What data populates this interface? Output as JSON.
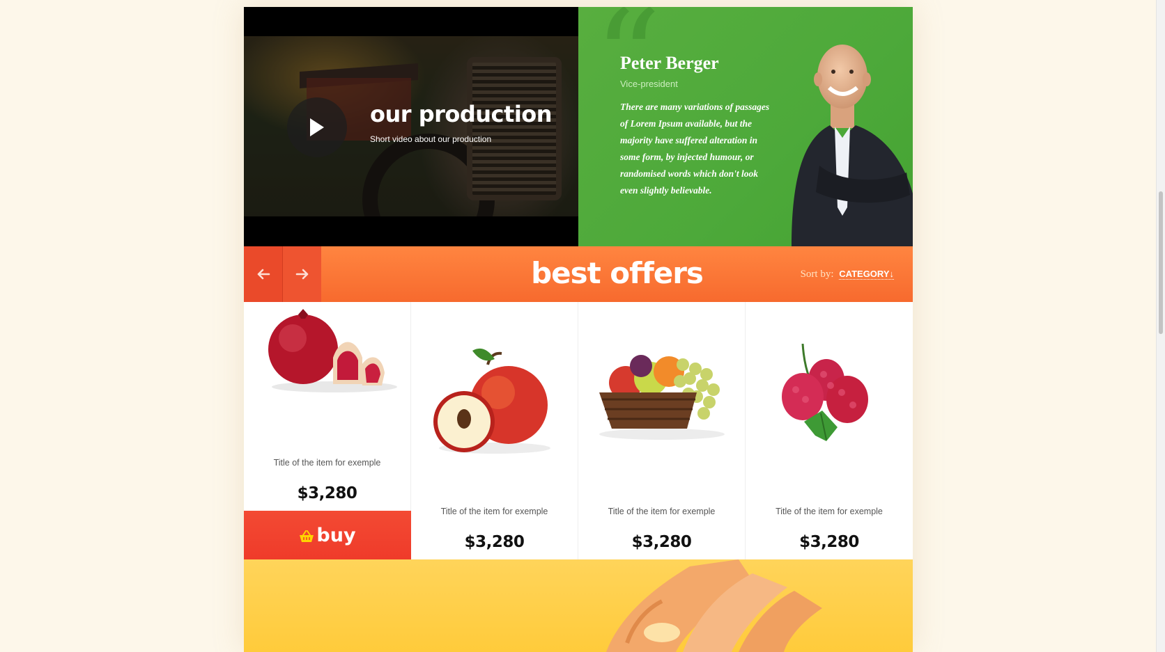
{
  "video": {
    "title": "our production",
    "subtitle": "Short video about our production"
  },
  "testimonial": {
    "name": "Peter Berger",
    "role": "Vice-president",
    "text": "There are many variations of passages of Lorem Ipsum available, but the majority have suffered alteration in some form, by injected humour, or randomised words which don't look even slightly believable."
  },
  "offers": {
    "title": "best offers",
    "sort_label": "Sort by:",
    "sort_value": "CATEGORY↓",
    "prev_icon": "arrow-left-icon",
    "next_icon": "arrow-right-icon"
  },
  "products": [
    {
      "title": "Title of the item for exemple",
      "price": "$3,280",
      "image": "pomegranate"
    },
    {
      "title": "Title of the item for exemple",
      "price": "$3,280",
      "image": "apples"
    },
    {
      "title": "Title of the item for exemple",
      "price": "$3,280",
      "image": "fruit-basket"
    },
    {
      "title": "Title of the item for exemple",
      "price": "$3,280",
      "image": "raspberries"
    }
  ],
  "buy_button": {
    "label": "buy",
    "icon": "basket-icon"
  },
  "colors": {
    "green": "#4da93a",
    "orange": "#f76a2e",
    "red": "#ef3b2a",
    "yellow": "#ffcb3b",
    "page_bg": "#fdf7ea"
  }
}
